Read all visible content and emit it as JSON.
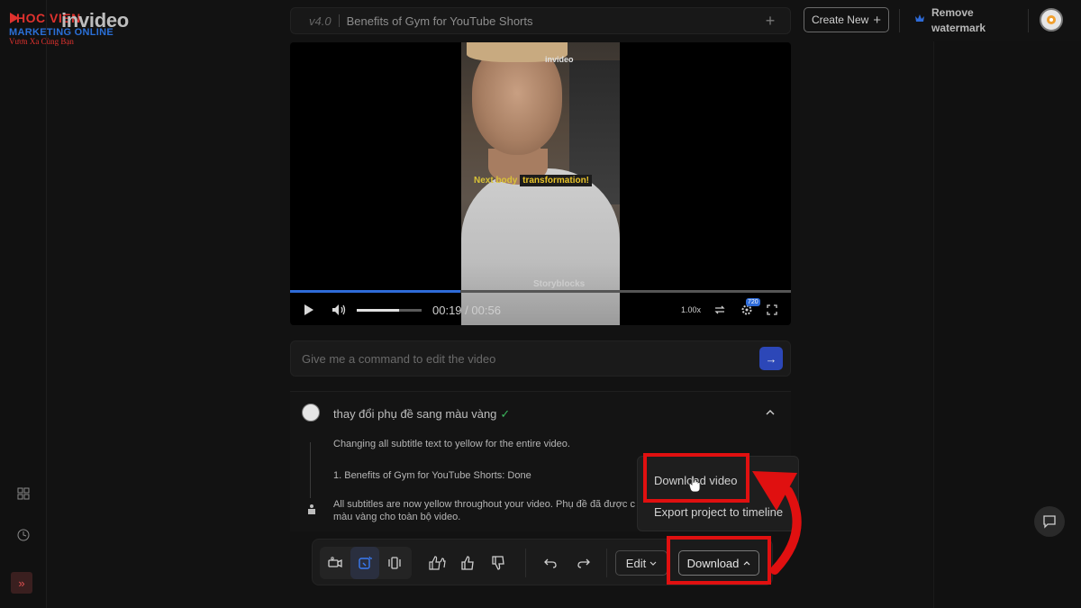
{
  "brand": {
    "top": "HOC VIEN",
    "mid": "MARKETING ONLINE",
    "sub": "Vươn Xa Cùng Bạn"
  },
  "app_logo": "invideo",
  "header": {
    "version": "v4.0",
    "project_title": "Benefits of Gym for YouTube Shorts",
    "create_new": "Create New",
    "remove_watermark": "Remove watermark"
  },
  "player": {
    "frame_logo": "invideo",
    "subtitle_prefix": "Next  body ",
    "subtitle_highlight": "transformation!",
    "watermark": "Storyblocks",
    "current_time": "00:19",
    "total_time": "00:56",
    "time_separator": " / ",
    "speed": "1.00x",
    "quality": "720",
    "progress": 0.34,
    "volume": 0.65
  },
  "command": {
    "placeholder": "Give me a command to edit the video"
  },
  "history": {
    "prompt": "thay đổi phụ đề sang màu vàng",
    "check": "✓",
    "step1": "Changing all subtitle text to yellow for the entire video.",
    "step2": "1. Benefits of Gym for YouTube Shorts: Done",
    "step3a": "All subtitles are now yellow throughout your video. Phụ đề đã được c",
    "step3b": "màu vàng cho toàn bộ video."
  },
  "toolbar": {
    "edit": "Edit",
    "download": "Download"
  },
  "menu": {
    "download_video": "Download video",
    "export_timeline": "Export project to timeline"
  },
  "colors": {
    "accent": "#2e6bd8",
    "highlight_red": "#e01010",
    "subtitle_yellow": "#e9c42a",
    "check_green": "#3bb55c"
  }
}
